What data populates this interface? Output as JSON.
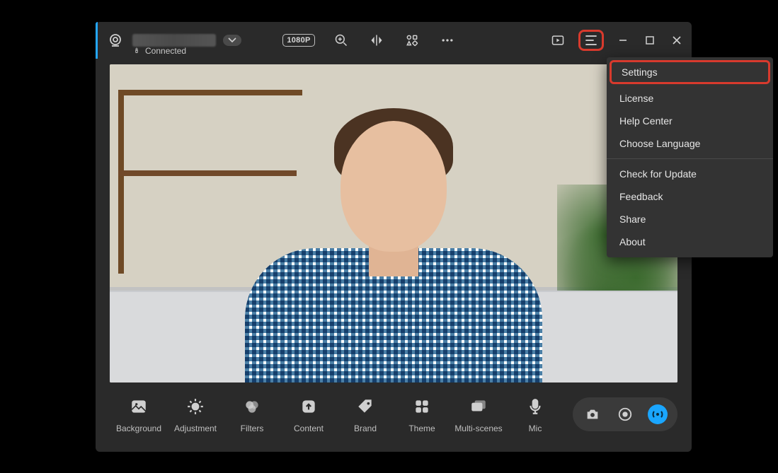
{
  "titlebar": {
    "status_label": "Connected",
    "resolution_chip": "1080P"
  },
  "menu": {
    "settings": "Settings",
    "license": "License",
    "help_center": "Help Center",
    "choose_language": "Choose Language",
    "check_update": "Check for Update",
    "feedback": "Feedback",
    "share": "Share",
    "about": "About"
  },
  "tools": {
    "background": "Background",
    "adjustment": "Adjustment",
    "filters": "Filters",
    "content": "Content",
    "brand": "Brand",
    "theme": "Theme",
    "multi_scenes": "Multi-scenes",
    "mic": "Mic"
  }
}
